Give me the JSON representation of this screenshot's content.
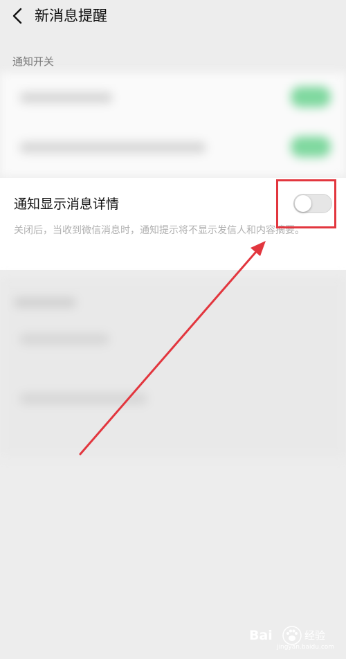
{
  "header": {
    "back_icon": "chevron-left-icon",
    "title": "新消息提醒"
  },
  "section": {
    "label": "通知开关"
  },
  "detail_setting": {
    "title": "通知显示消息详情",
    "description": "关闭后，当收到微信消息时，通知提示将不显示发信人和内容摘要。",
    "toggle_state": "off"
  },
  "annotation": {
    "highlight_color": "#e2363e",
    "arrow_color": "#e2363e"
  },
  "watermark": {
    "brand_left": "Bai",
    "brand_right": "经验",
    "url": "jingyan.baidu.com"
  },
  "colors": {
    "background": "#ededed",
    "card": "#ffffff",
    "switch_on": "#07c160",
    "switch_off": "#e6e6e6"
  }
}
